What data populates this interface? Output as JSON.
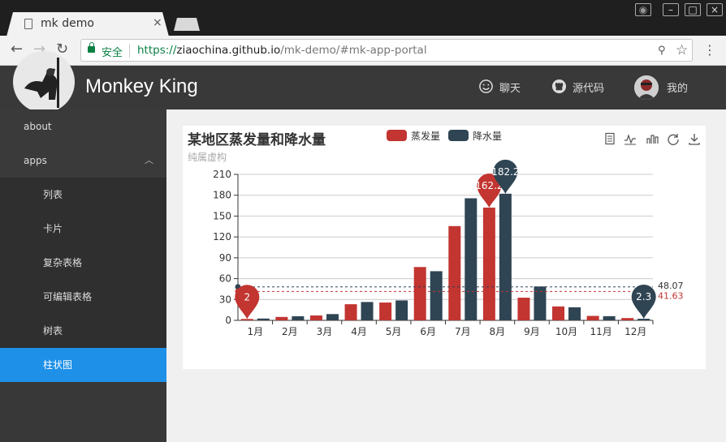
{
  "browser": {
    "tab_title": "mk demo",
    "tab_close": "×",
    "secure_label": "安全",
    "url_scheme": "https://",
    "url_host": "ziaochina.github.io",
    "url_path": "/mk-demo/#mk-app-portal"
  },
  "header": {
    "title": "Monkey King",
    "chat_label": "聊天",
    "source_label": "源代码",
    "me_label": "我的"
  },
  "sidebar": {
    "items": [
      {
        "label": "about"
      },
      {
        "label": "apps"
      },
      {
        "label": "列表"
      },
      {
        "label": "卡片"
      },
      {
        "label": "复杂表格"
      },
      {
        "label": "可编辑表格"
      },
      {
        "label": "树表"
      },
      {
        "label": "柱状图"
      }
    ]
  },
  "chart": {
    "title": "某地区蒸发量和降水量",
    "subtitle": "纯属虚构",
    "legend": [
      {
        "name": "蒸发量",
        "color": "#c23531"
      },
      {
        "name": "降水量",
        "color": "#2f4554"
      }
    ]
  },
  "chart_data": {
    "type": "bar",
    "title": "某地区蒸发量和降水量",
    "subtitle": "纯属虚构",
    "categories": [
      "1月",
      "2月",
      "3月",
      "4月",
      "5月",
      "6月",
      "7月",
      "8月",
      "9月",
      "10月",
      "11月",
      "12月"
    ],
    "series": [
      {
        "name": "蒸发量",
        "color": "#c23531",
        "values": [
          2.0,
          4.9,
          7.0,
          23.2,
          25.6,
          76.7,
          135.6,
          162.2,
          32.6,
          20.0,
          6.4,
          3.3
        ]
      },
      {
        "name": "降水量",
        "color": "#2f4554",
        "values": [
          2.6,
          5.9,
          9.0,
          26.4,
          28.7,
          70.7,
          175.6,
          182.2,
          48.7,
          18.8,
          6.0,
          2.3
        ]
      }
    ],
    "ylim": [
      0,
      210
    ],
    "yticks": [
      0,
      30,
      60,
      90,
      120,
      150,
      180,
      210
    ],
    "mark_points": [
      {
        "series": 0,
        "category": "1月",
        "label": "2",
        "value": 2.0
      },
      {
        "series": 0,
        "category": "8月",
        "label": "162.2",
        "value": 162.2
      },
      {
        "series": 1,
        "category": "8月",
        "label": "182.2",
        "value": 182.2
      },
      {
        "series": 1,
        "category": "12月",
        "label": "2.3",
        "value": 2.3
      }
    ],
    "mark_lines": [
      {
        "series": 1,
        "label": "48.07",
        "value": 48.07
      },
      {
        "series": 0,
        "label": "41.63",
        "value": 41.63
      }
    ],
    "grid": "horizontal",
    "legend_position": "top-center"
  }
}
